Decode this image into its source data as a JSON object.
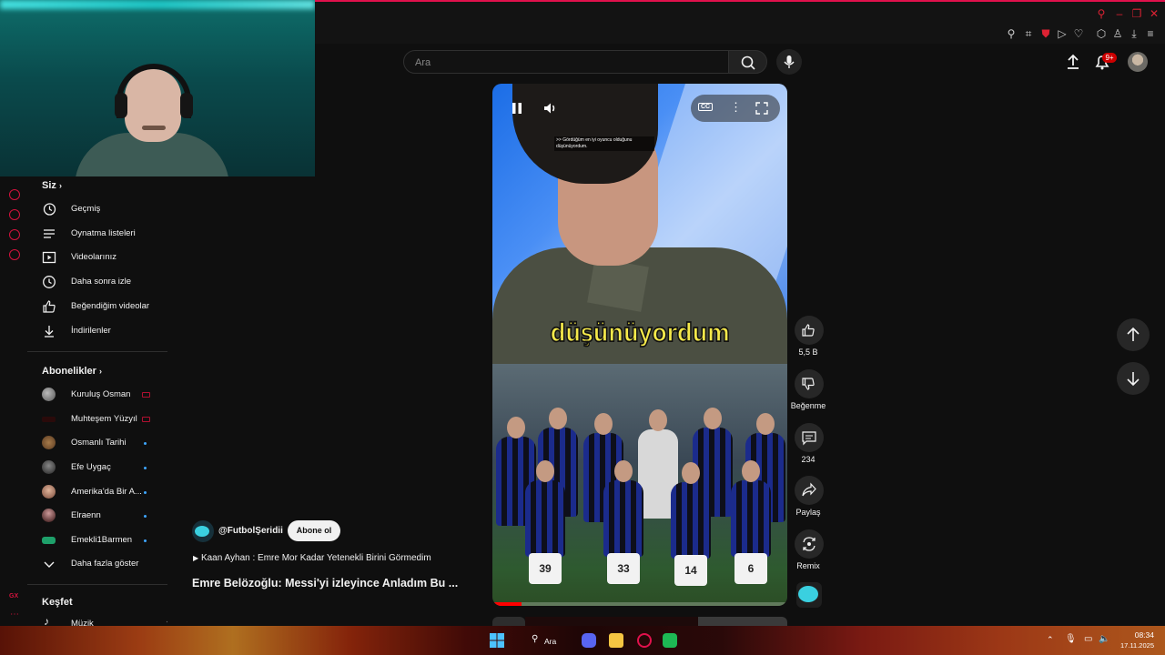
{
  "search": {
    "placeholder": "Ara"
  },
  "header": {
    "notification_count": "9+"
  },
  "sidebar": {
    "you_heading": "Siz",
    "you_items": [
      {
        "label": "Geçmiş",
        "icon": "history-icon"
      },
      {
        "label": "Oynatma listeleri",
        "icon": "playlist-icon"
      },
      {
        "label": "Videolarınız",
        "icon": "your-videos-icon"
      },
      {
        "label": "Daha sonra izle",
        "icon": "watch-later-icon"
      },
      {
        "label": "Beğendiğim videolar",
        "icon": "liked-icon"
      },
      {
        "label": "İndirilenler",
        "icon": "download-icon"
      }
    ],
    "subscriptions_heading": "Abonelikler",
    "subscriptions": [
      {
        "label": "Kuruluş Osman",
        "status": "live"
      },
      {
        "label": "Muhteşem Yüzyıl",
        "status": "live"
      },
      {
        "label": "Osmanlı Tarihi",
        "status": "new"
      },
      {
        "label": "Efe Uygaç",
        "status": "new"
      },
      {
        "label": "Amerika'da Bir A...",
        "status": "new"
      },
      {
        "label": "Elraenn",
        "status": "new"
      },
      {
        "label": "Emekli1Barmen",
        "status": "new"
      }
    ],
    "show_more": "Daha fazla göster",
    "explore_heading": "Keşfet",
    "explore_items": [
      {
        "label": "Müzik",
        "icon": "music-icon"
      }
    ],
    "opera_badge": "GX"
  },
  "video": {
    "subtitle": "düşünüyordum",
    "cc_caption": ">> Gördüğüm en iyi oyuncu olduğunu düşünüyordum.",
    "cc_label": "CC",
    "jersey_numbers": [
      "39",
      "33",
      "14",
      "6"
    ],
    "progress_fraction": 0.1
  },
  "actions": {
    "likes": "5,5 B",
    "dislike": "Beğenme",
    "comments": "234",
    "share": "Paylaş",
    "remix": "Remix"
  },
  "info": {
    "channel": "@FutbolŞeridii",
    "subscribe": "Abone ol",
    "music": "Kaan Ayhan : Emre Mor Kadar Yetenekli Birini Görmedim",
    "title": "Emre Belözoğlu: Messi'yi izleyince Anladım Bu ..."
  },
  "taskbar": {
    "search": "Ara",
    "time": "08:34",
    "date": "17.11.2025"
  },
  "colors": {
    "accent": "#e0114c",
    "yt_red": "#ff0000",
    "subtitle": "#f5e94a"
  }
}
